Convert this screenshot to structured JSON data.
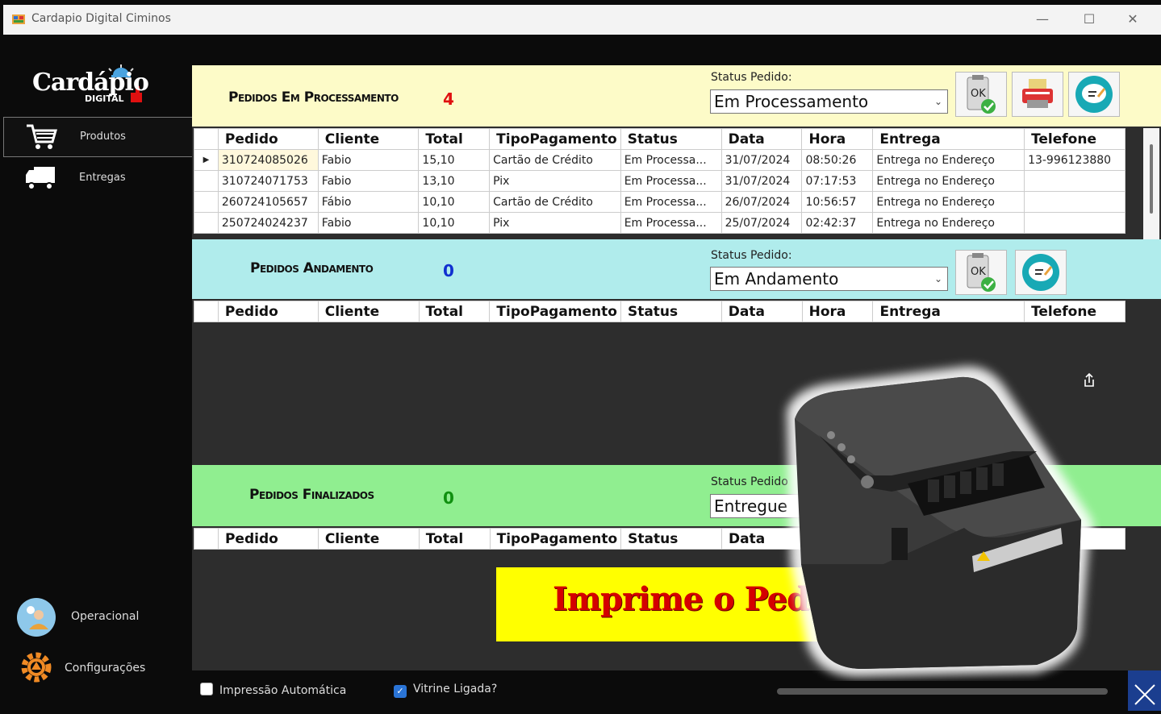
{
  "window": {
    "title": "Cardapio Digital Ciminos",
    "minimize": "—",
    "maximize": "☐",
    "close": "✕"
  },
  "logo": {
    "name": "Cardápio",
    "sub": "DIGITAL"
  },
  "sidebar": {
    "items": [
      {
        "label": "Produtos",
        "icon": "cart-icon"
      },
      {
        "label": "Entregas",
        "icon": "truck-icon"
      }
    ],
    "bottom": [
      {
        "label": "Operacional",
        "icon": "operator-icon"
      },
      {
        "label": "Configurações",
        "icon": "gear-icon"
      }
    ]
  },
  "columns": [
    "Pedido",
    "Cliente",
    "Total",
    "TipoPagamento",
    "Status",
    "Data",
    "Hora",
    "Entrega",
    "Telefone"
  ],
  "processing": {
    "title": "Pedidos Em Processamento",
    "count": "4",
    "status_label": "Status Pedido:",
    "status_value": "Em Processamento",
    "rows": [
      [
        "310724085026",
        "Fabio",
        "15,10",
        "Cartão de Crédito",
        "Em Processa...",
        "31/07/2024",
        "08:50:26",
        "Entrega no Endereço",
        "13-996123880"
      ],
      [
        "310724071753",
        "Fabio",
        "13,10",
        "Pix",
        "Em Processa...",
        "31/07/2024",
        "07:17:53",
        "Entrega no Endereço",
        ""
      ],
      [
        "260724105657",
        "Fábio",
        "10,10",
        "Cartão de Crédito",
        "Em Processa...",
        "26/07/2024",
        "10:56:57",
        "Entrega no Endereço",
        ""
      ],
      [
        "250724024237",
        "Fabio",
        "10,10",
        "Pix",
        "Em Processa...",
        "25/07/2024",
        "02:42:37",
        "Entrega no Endereço",
        ""
      ]
    ]
  },
  "progress": {
    "title": "Pedidos Andamento",
    "count": "0",
    "status_label": "Status Pedido:",
    "status_value": "Em Andamento"
  },
  "finished": {
    "title": "Pedidos Finalizados",
    "count": "0",
    "status_label": "Status Pedido",
    "status_value": "Entregue"
  },
  "footer": {
    "auto_print": "Impressão Automática",
    "vitrine": "Vitrine Ligada?"
  },
  "banner": {
    "text": "Imprime o Pedido"
  },
  "colors": {
    "processing_bg": "#fdfbc8",
    "progress_bg": "#b0ecec",
    "finished_bg": "#90ee90",
    "count_red": "#e01010",
    "count_blue": "#1030d0",
    "count_green": "#109010"
  }
}
